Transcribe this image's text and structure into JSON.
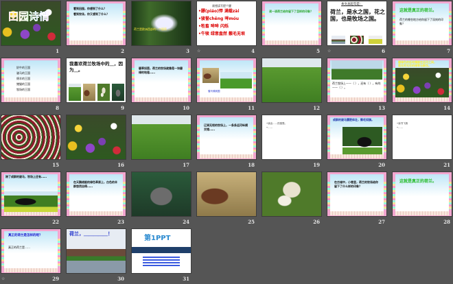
{
  "view": "slide-sorter",
  "slides": [
    {
      "number": "1",
      "kind": "title-photo",
      "title": "田园诗情"
    },
    {
      "number": "2",
      "kind": "frame",
      "lines": [
        "看到田园，你想到了什么？",
        "看到牧场，你又想到了什么？"
      ]
    },
    {
      "number": "3",
      "kind": "waterfall",
      "lines": [
        "荷兰是欧洲西部的一个国家……"
      ]
    },
    {
      "number": "4",
      "kind": "white-words",
      "has_transition": true,
      "title": "易错读写提个醒",
      "lines": [
        "•膘(piáo)悍  满载zài",
        "•骏誉chēng  哞móu",
        "•牲畜   哞哞 闪烁",
        "•牛犊 绿意盎然 鬃毛无垠"
      ]
    },
    {
      "number": "5",
      "kind": "frame",
      "color": "#2fa82f",
      "lines": [
        "读一读荷兰给你留下了怎样的印象？"
      ]
    },
    {
      "number": "6",
      "kind": "white-topic",
      "has_transition": true,
      "title": "本文总起句是：",
      "lines": [
        "荷兰，是水之国，花之国，也是牧场之国。"
      ]
    },
    {
      "number": "7",
      "kind": "frame-title",
      "title": "这就是真正的荷兰。",
      "lines": [
        "荷兰的哪些地方给你留下了深刻的印象？"
      ]
    },
    {
      "number": "8",
      "kind": "frame-list",
      "lines": [
        "奶牛的王国",
        "骏马的王国",
        "绵羊的王国",
        "猪猫的王国",
        "牧场的王国"
      ]
    },
    {
      "number": "9",
      "kind": "white-animals",
      "lines": [
        "我喜欢荷兰牧场中的＿，因为＿。"
      ]
    },
    {
      "number": "10",
      "kind": "frame",
      "lines": [
        "碧草如茵，荷兰的牧场就像是一块碧绿的地毯……"
      ]
    },
    {
      "number": "11",
      "kind": "frame-pics",
      "lines": [
        "骏马骑到国"
      ]
    },
    {
      "number": "12",
      "kind": "photo",
      "photo": "cows"
    },
    {
      "number": "13",
      "kind": "frame-fill",
      "lines": [
        "荷兰牧场上——（ ），还有（ ），有的——（ ）。"
      ]
    },
    {
      "number": "14",
      "kind": "flowers-text",
      "lines": [
        "碧绿色的低地镶嵌在运河之间，",
        "是无穷无尽的绿草与鲜花。"
      ]
    },
    {
      "number": "15",
      "kind": "photo",
      "photo": "tulips"
    },
    {
      "number": "16",
      "kind": "photo",
      "photo": "flowers"
    },
    {
      "number": "17",
      "kind": "photo",
      "photo": "cows"
    },
    {
      "number": "18",
      "kind": "frame",
      "lines": [
        "辽阔无垠的牧场上，一条条运河纵横交错……"
      ]
    },
    {
      "number": "19",
      "kind": "white-bullets",
      "lines": [
        "•读出……的感受。",
        "•……"
      ]
    },
    {
      "number": "20",
      "kind": "frame-horse",
      "lines": [
        "成群的骏马膘肥体壮，鬃毛如旗。"
      ]
    },
    {
      "number": "21",
      "kind": "white-bullets",
      "lines": [
        "•读书飞扬",
        "•……"
      ]
    },
    {
      "number": "22",
      "kind": "frame-horse2",
      "lines": [
        "除了成群的骏马，牧场上还有……"
      ]
    },
    {
      "number": "23",
      "kind": "frame",
      "lines": [
        "在天鹅绒般的绿色草原上，白色的羊群悠然自得……"
      ]
    },
    {
      "number": "24",
      "kind": "photo",
      "photo": "pig"
    },
    {
      "number": "25",
      "kind": "photo",
      "photo": "goat"
    },
    {
      "number": "26",
      "kind": "photo",
      "photo": "sheep"
    },
    {
      "number": "27",
      "kind": "frame",
      "lines": [
        "在古城中，小巷里，荷兰的牧场给你留下了什么样的印象？"
      ]
    },
    {
      "number": "28",
      "kind": "frame-title",
      "title": "这就是真正的荷兰。",
      "lines": []
    },
    {
      "number": "29",
      "kind": "frame-title",
      "has_transition": true,
      "title": "真正的荷兰是怎样的呢？",
      "color": "#1a1ad0",
      "lines": [
        "真正的荷兰是……"
      ]
    },
    {
      "number": "30",
      "kind": "city",
      "title": "荷兰，＿＿＿＿＿！"
    },
    {
      "number": "31",
      "kind": "logo",
      "title": "第1PPT"
    }
  ],
  "transition_icon": "☆"
}
